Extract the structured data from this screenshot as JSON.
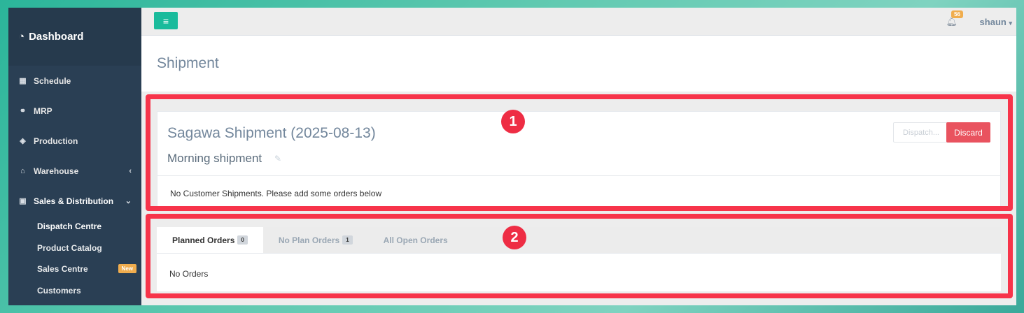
{
  "sidebar": {
    "brand": "Dashboard",
    "items": [
      {
        "label": "Schedule",
        "icon": "grid-icon"
      },
      {
        "label": "MRP",
        "icon": "cubes-icon"
      },
      {
        "label": "Production",
        "icon": "cube-icon"
      },
      {
        "label": "Warehouse",
        "icon": "warehouse-icon",
        "chevron": "‹"
      },
      {
        "label": "Sales & Distribution",
        "icon": "money-icon",
        "chevron": "⌄"
      }
    ],
    "submenu": [
      {
        "label": "Dispatch Centre"
      },
      {
        "label": "Product Catalog"
      },
      {
        "label": "Sales Centre",
        "badge": "New"
      },
      {
        "label": "Customers"
      }
    ]
  },
  "topbar": {
    "notifications": "56",
    "user": "shaun"
  },
  "page": {
    "title": "Shipment"
  },
  "shipment": {
    "title": "Sagawa Shipment (2025-08-13)",
    "subtitle": "Morning shipment",
    "dispatch_label": "Dispatch...",
    "discard_label": "Discard",
    "empty_text": "No Customer Shipments. Please add some orders below"
  },
  "orders": {
    "tabs": [
      {
        "label": "Planned Orders",
        "count": "0"
      },
      {
        "label": "No Plan Orders",
        "count": "1"
      },
      {
        "label": "All Open Orders"
      }
    ],
    "empty_text": "No Orders"
  },
  "annotations": [
    "1",
    "2"
  ],
  "colors": {
    "accent": "#1abb9c",
    "danger": "#e9535f",
    "annotation": "#f7344a",
    "sidebar": "#2a3f54"
  }
}
